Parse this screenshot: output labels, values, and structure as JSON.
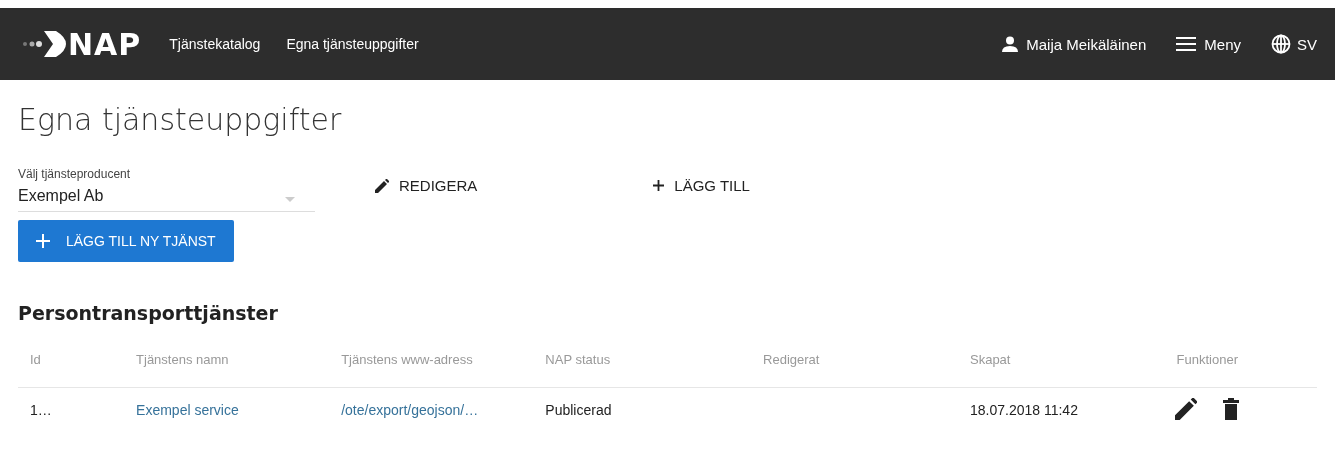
{
  "header": {
    "logo": "NAP",
    "nav": [
      {
        "label": "Tjänstekatalog"
      },
      {
        "label": "Egna tjänsteuppgifter"
      }
    ],
    "user": "Maija Meikäläinen",
    "menu": "Meny",
    "language": "SV"
  },
  "page_title": "Egna tjänsteuppgifter",
  "producer_select": {
    "label": "Välj tjänsteproducent",
    "value": "Exempel Ab"
  },
  "actions": [
    {
      "kind": "edit",
      "label": "REDIGERA"
    },
    {
      "kind": "add",
      "label": "LÄGG TILL"
    }
  ],
  "add_service_button": "LÄGG TILL NY TJÄNST",
  "section_title": "Persontransporttjänster",
  "table": {
    "columns": [
      "Id",
      "Tjänstens namn",
      "Tjänstens www-adress",
      "NAP status",
      "Redigerat",
      "Skapat",
      "Funktioner"
    ],
    "rows": [
      {
        "id": "1…",
        "name": "Exempel service",
        "url": "/ote/export/geojson/…",
        "status": "Publicerad",
        "created": "18.07.2018 11:42"
      }
    ]
  }
}
